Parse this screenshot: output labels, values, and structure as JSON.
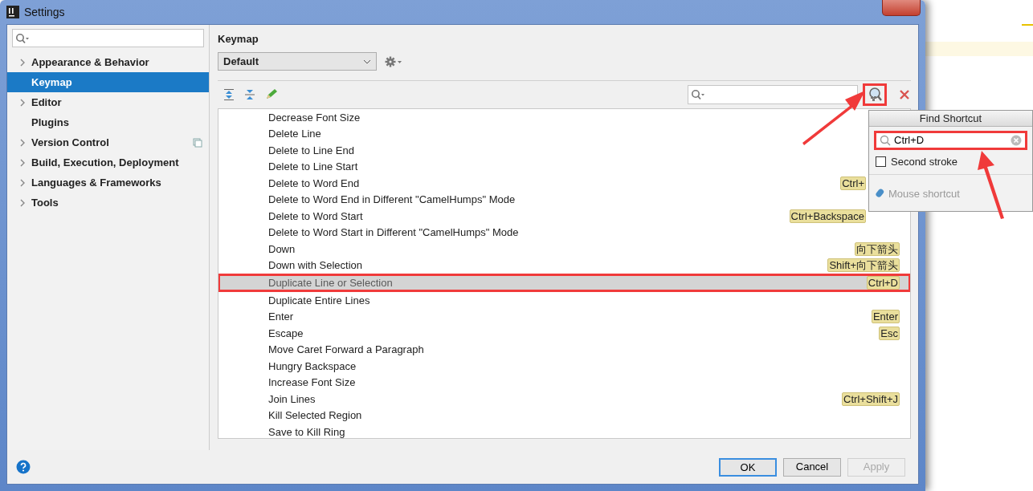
{
  "window": {
    "title": "Settings"
  },
  "sidebar": {
    "items": [
      {
        "label": "Appearance & Behavior",
        "expandable": true,
        "selected": false,
        "project_scope": false
      },
      {
        "label": "Keymap",
        "expandable": false,
        "selected": true,
        "project_scope": false
      },
      {
        "label": "Editor",
        "expandable": true,
        "selected": false,
        "project_scope": false
      },
      {
        "label": "Plugins",
        "expandable": false,
        "selected": false,
        "project_scope": false
      },
      {
        "label": "Version Control",
        "expandable": true,
        "selected": false,
        "project_scope": true
      },
      {
        "label": "Build, Execution, Deployment",
        "expandable": true,
        "selected": false,
        "project_scope": false
      },
      {
        "label": "Languages & Frameworks",
        "expandable": true,
        "selected": false,
        "project_scope": false
      },
      {
        "label": "Tools",
        "expandable": true,
        "selected": false,
        "project_scope": false
      }
    ]
  },
  "main": {
    "heading": "Keymap",
    "keymap": "Default",
    "find_shortcut_annotated": true,
    "actions": [
      {
        "action": "Decrease Font Size",
        "selected": false
      },
      {
        "action": "Delete Line",
        "selected": false
      },
      {
        "action": "Delete to Line End",
        "selected": false
      },
      {
        "action": "Delete to Line Start",
        "selected": false
      },
      {
        "action": "Delete to Word End",
        "shortcut": "Ctrl+",
        "selected": false
      },
      {
        "action": "Delete to Word End in Different \"CamelHumps\" Mode",
        "selected": false
      },
      {
        "action": "Delete to Word Start",
        "shortcut": "Ctrl+Backspace",
        "selected": false
      },
      {
        "action": "Delete to Word Start in Different \"CamelHumps\" Mode",
        "selected": false
      },
      {
        "action": "Down",
        "shortcut": "向下箭头",
        "selected": false
      },
      {
        "action": "Down with Selection",
        "shortcut": "Shift+向下箭头",
        "selected": false
      },
      {
        "action": "Duplicate Line or Selection",
        "shortcut": "Ctrl+D",
        "selected": true,
        "annotated": true
      },
      {
        "action": "Duplicate Entire Lines",
        "selected": false
      },
      {
        "action": "Enter",
        "shortcut": "Enter",
        "selected": false
      },
      {
        "action": "Escape",
        "shortcut": "Esc",
        "selected": false
      },
      {
        "action": "Move Caret Forward a Paragraph",
        "selected": false
      },
      {
        "action": "Hungry Backspace",
        "selected": false
      },
      {
        "action": "Increase Font Size",
        "selected": false
      },
      {
        "action": "Join Lines",
        "shortcut": "Ctrl+Shift+J",
        "selected": false
      },
      {
        "action": "Kill Selected Region",
        "selected": false
      },
      {
        "action": "Save to Kill Ring",
        "selected": false
      }
    ]
  },
  "find_shortcut": {
    "title": "Find Shortcut",
    "value": "Ctrl+D",
    "annotated": true,
    "second_stroke": {
      "label": "Second stroke",
      "checked": false
    },
    "mouse_shortcut": {
      "label": "Mouse shortcut",
      "disabled": true
    }
  },
  "buttons": [
    {
      "label": "OK",
      "kind": "default",
      "disabled": false
    },
    {
      "label": "Cancel",
      "kind": "normal",
      "disabled": false
    },
    {
      "label": "Apply",
      "kind": "normal",
      "disabled": true
    }
  ]
}
